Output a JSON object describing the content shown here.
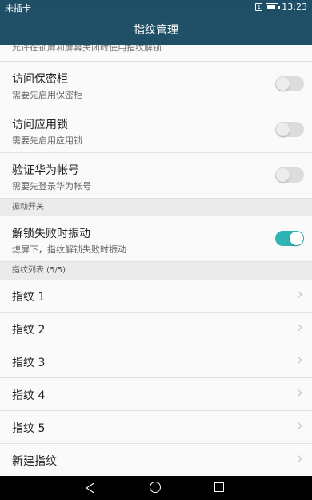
{
  "status_bar": {
    "carrier": "未插卡",
    "sim_label": "1",
    "time": "13:23",
    "battery_level": 0.85
  },
  "app_bar": {
    "title": "指纹管理"
  },
  "partial_item": {
    "subtitle": "允许在锁屏和屏幕关闭时使用指纹解锁"
  },
  "toggle_items": [
    {
      "title": "访问保密柜",
      "subtitle": "需要先启用保密柜",
      "on": false
    },
    {
      "title": "访问应用锁",
      "subtitle": "需要先启用应用锁",
      "on": false
    },
    {
      "title": "验证华为帐号",
      "subtitle": "需要先登录华为帐号",
      "on": false
    }
  ],
  "vibration_section": {
    "header": "振动开关",
    "item": {
      "title": "解锁失败时振动",
      "subtitle": "熄屏下，指纹解锁失败时振动",
      "on": true
    }
  },
  "fingerprint_section": {
    "header": "指纹列表 (5/5)",
    "items": [
      "指纹 1",
      "指纹 2",
      "指纹 3",
      "指纹 4",
      "指纹 5",
      "新建指纹"
    ]
  },
  "colors": {
    "app_bar": "#1f5068",
    "switch_on": "#2fb4b4",
    "switch_off": "#dcdcdc"
  },
  "nav_bar": {
    "icons": [
      "back-icon",
      "home-icon",
      "recents-icon"
    ]
  }
}
